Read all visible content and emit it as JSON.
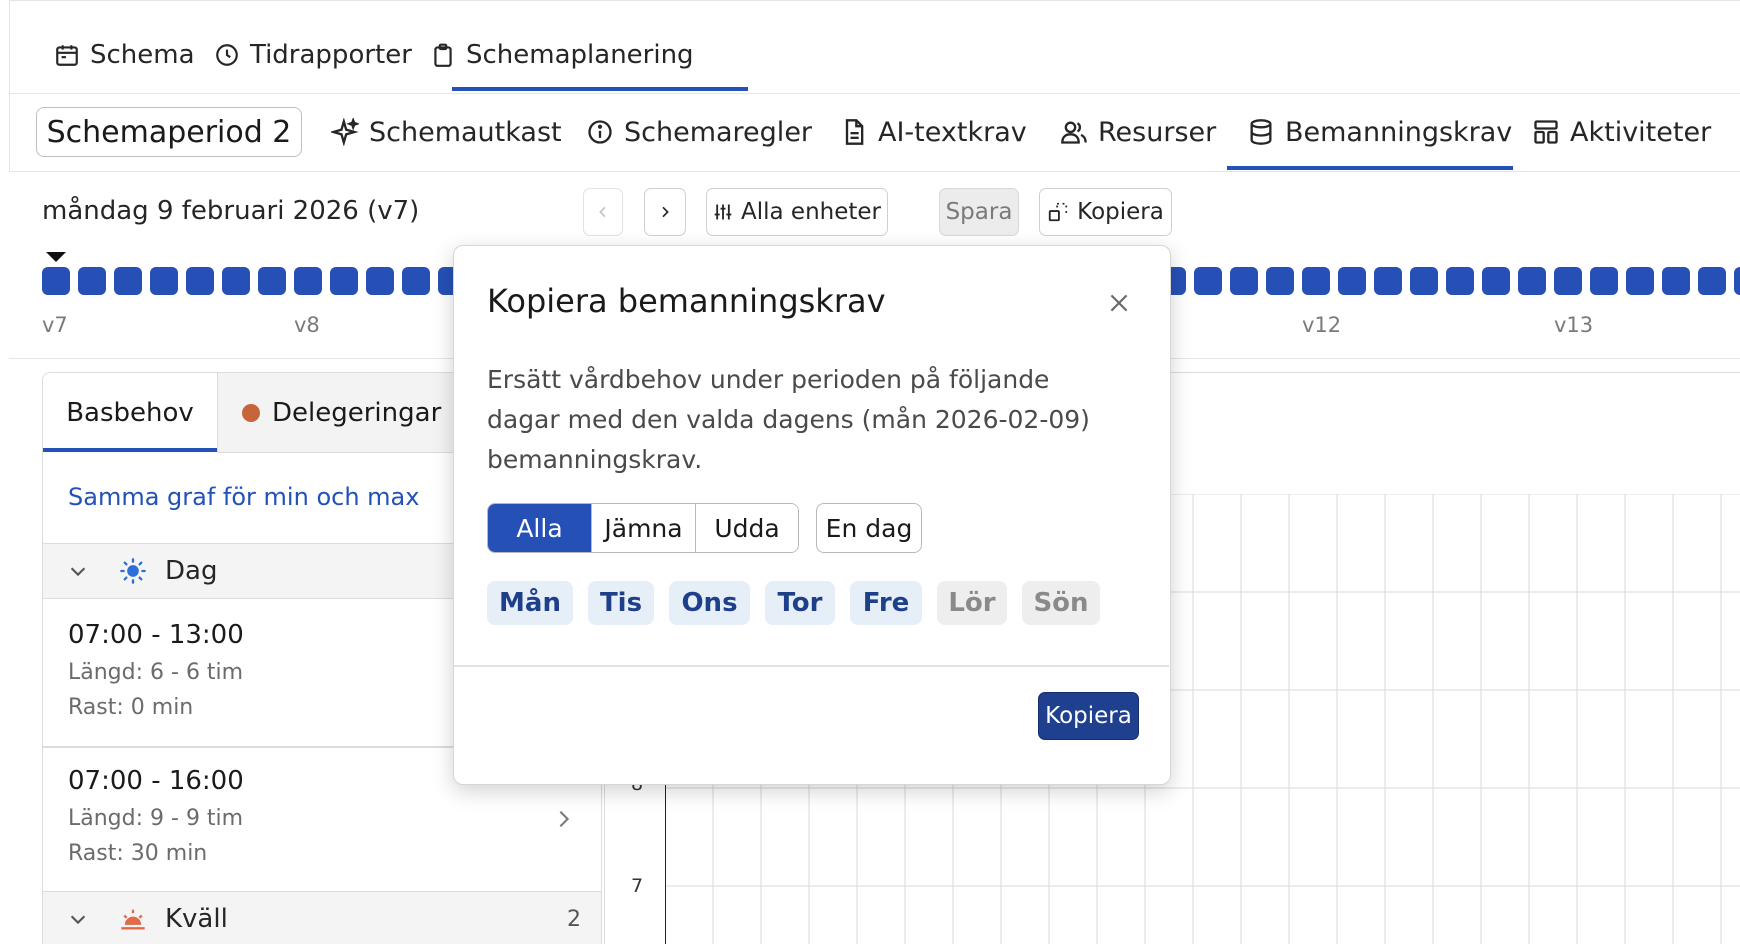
{
  "topnav": {
    "items": [
      {
        "label": "Schema",
        "icon": "calendar-icon"
      },
      {
        "label": "Tidrapporter",
        "icon": "clock-icon"
      },
      {
        "label": "Schemaplanering",
        "icon": "clipboard-icon"
      }
    ],
    "active_index": 2
  },
  "subnav": {
    "period_label": "Schemaperiod 2",
    "items": [
      {
        "label": "Schemautkast",
        "icon": "sparkle-icon"
      },
      {
        "label": "Schemaregler",
        "icon": "info-icon"
      },
      {
        "label": "AI-textkrav",
        "icon": "document-icon"
      },
      {
        "label": "Resurser",
        "icon": "users-icon"
      },
      {
        "label": "Bemanningskrav",
        "icon": "database-icon"
      },
      {
        "label": "Aktiviteter",
        "icon": "activities-icon"
      }
    ],
    "active": "Bemanningskrav"
  },
  "toolbar": {
    "date_label": "måndag 9 februari 2026 (v7)",
    "units_label": "Alla enheter",
    "save_label": "Spara",
    "copy_label": "Kopiera"
  },
  "weekstrip": {
    "week_labels": [
      "v7",
      "v8",
      "v12",
      "v13"
    ],
    "selected_week": "v7",
    "accent": "#2650b5"
  },
  "leftpanel": {
    "tabs": [
      {
        "label": "Basbehov"
      },
      {
        "label": "Delegeringar",
        "dot_color": "#c8643a"
      }
    ],
    "same_graph_link": "Samma graf för min och max",
    "groups": [
      {
        "label": "Dag",
        "icon": "sun-icon"
      },
      {
        "label": "Kväll",
        "icon": "sunset-icon",
        "count": "2"
      }
    ],
    "shifts": [
      {
        "time": "07:00 - 13:00",
        "length": "Längd: 6 - 6 tim",
        "break": "Rast: 0 min"
      },
      {
        "time": "07:00 - 16:00",
        "length": "Längd: 9 - 9 tim",
        "break": "Rast: 30 min"
      }
    ]
  },
  "chart": {
    "y_tick_labels": [
      "8",
      "7"
    ]
  },
  "modal": {
    "title": "Kopiera bemanningskrav",
    "description": "Ersätt vårdbehov under perioden på följande dagar med den valda dagens (mån 2026-02-09) bemanningskrav.",
    "segments": [
      "Alla",
      "Jämna",
      "Udda"
    ],
    "active_segment": "Alla",
    "single_day_label": "En dag",
    "days": [
      {
        "label": "Mån",
        "selected": true
      },
      {
        "label": "Tis",
        "selected": true
      },
      {
        "label": "Ons",
        "selected": true
      },
      {
        "label": "Tor",
        "selected": true
      },
      {
        "label": "Fre",
        "selected": true
      },
      {
        "label": "Lör",
        "selected": false
      },
      {
        "label": "Sön",
        "selected": false
      }
    ],
    "confirm_label": "Kopiera",
    "primary_color": "#2550b5"
  }
}
